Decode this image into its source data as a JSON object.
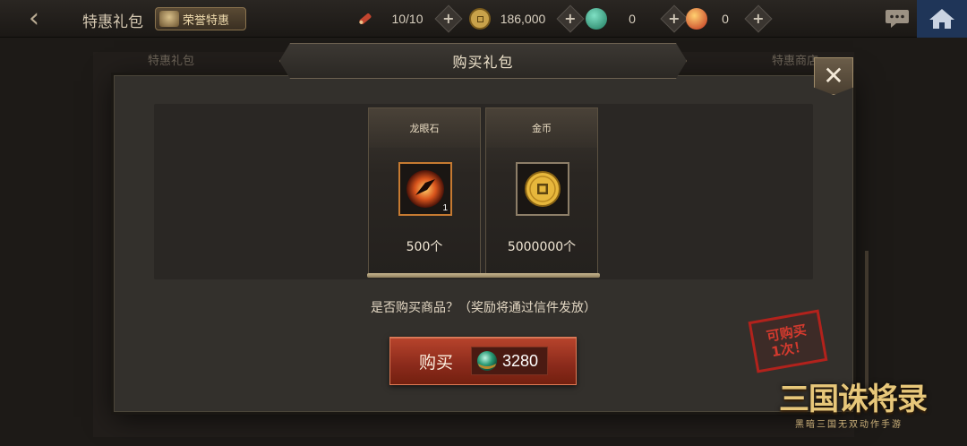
{
  "topbar": {
    "title": "特惠礼包",
    "honor_tag": "荣誉特惠",
    "resources": [
      {
        "icon": "scroll-icon",
        "value": "10/10"
      },
      {
        "icon": "coin-icon",
        "value": "186,000"
      },
      {
        "icon": "jade-icon",
        "value": "0"
      },
      {
        "icon": "orb-icon",
        "value": "0"
      }
    ]
  },
  "background": {
    "tab_left": "特惠礼包",
    "tab_right": "特惠商店"
  },
  "dialog": {
    "title": "购买礼包",
    "items": [
      {
        "name": "龙眼石",
        "amount": "500个",
        "badge": "1",
        "icon": "dragon-eye-stone-icon"
      },
      {
        "name": "金币",
        "amount": "5000000个",
        "icon": "gold-coin-icon"
      }
    ],
    "confirm_text": "是否购买商品？（奖励将通过信件发放）",
    "buy_label": "购买",
    "price": "3280",
    "price_icon": "jade-icon",
    "limit_line1": "可购买",
    "limit_line2": "1次！"
  },
  "logo": {
    "main": "三国诛将录",
    "sub": "黑暗三国无双动作手游"
  },
  "colors": {
    "buy_button": "#9a3322",
    "home_button": "#1f3558",
    "stamp": "#b2221c"
  }
}
